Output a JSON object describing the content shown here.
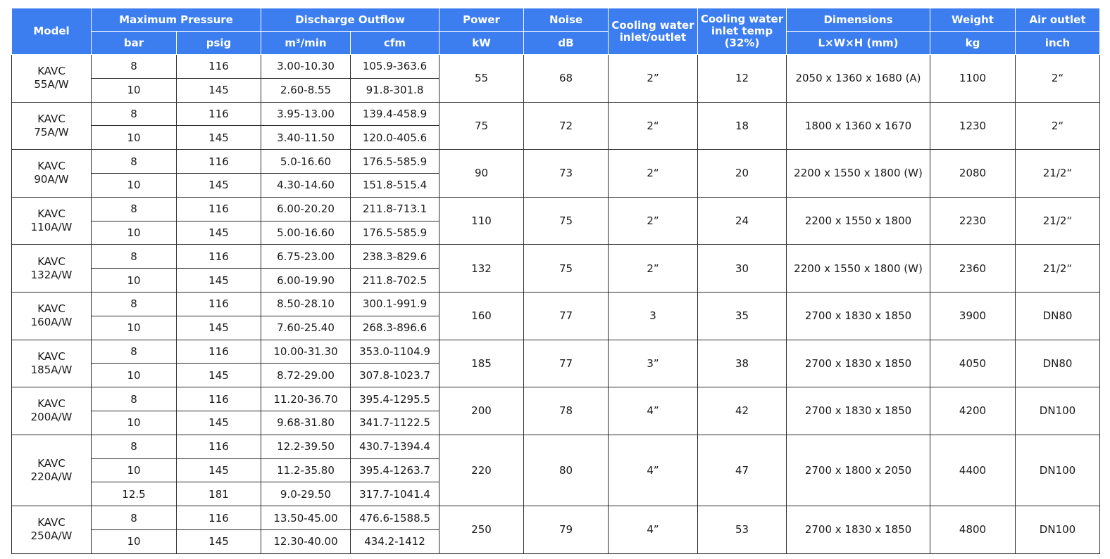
{
  "header": {
    "model": "Model",
    "max_pressure": "Maximum Pressure",
    "discharge": "Discharge Outflow",
    "power": "Power",
    "noise": "Noise",
    "cooling_io": "Cooling water inlet/outlet",
    "cooling_temp": "Cooling water inlet temp (32%)",
    "dimensions": "Dimensions",
    "weight": "Weight",
    "air_outlet": "Air outlet",
    "units": {
      "bar": "bar",
      "psig": "psig",
      "m3": "m³/min",
      "cfm": "cfm",
      "kw": "kW",
      "db": "dB",
      "lwh": "L×W×H (mm)",
      "kg": "kg",
      "inch": "inch"
    }
  },
  "models": [
    {
      "brand": "KAVC",
      "code": "55A/W",
      "power": "55",
      "noise": "68",
      "cooling_io": "2”",
      "cooling_temp": "12",
      "dimensions": "2050 x 1360 x 1680 (A)",
      "weight": "1100",
      "air_outlet": "2“",
      "rows": [
        {
          "bar": "8",
          "psig": "116",
          "m3": "3.00-10.30",
          "cfm": "105.9-363.6"
        },
        {
          "bar": "10",
          "psig": "145",
          "m3": "2.60-8.55",
          "cfm": "91.8-301.8"
        }
      ]
    },
    {
      "brand": "KAVC",
      "code": "75A/W",
      "power": "75",
      "noise": "72",
      "cooling_io": "2“",
      "cooling_temp": "18",
      "dimensions": "1800 x 1360 x 1670",
      "weight": "1230",
      "air_outlet": "2“",
      "rows": [
        {
          "bar": "8",
          "psig": "116",
          "m3": "3.95-13.00",
          "cfm": "139.4-458.9"
        },
        {
          "bar": "10",
          "psig": "145",
          "m3": "3.40-11.50",
          "cfm": "120.0-405.6"
        }
      ]
    },
    {
      "brand": "KAVC",
      "code": "90A/W",
      "power": "90",
      "noise": "73",
      "cooling_io": "2“",
      "cooling_temp": "20",
      "dimensions": "2200 x 1550 x 1800 (W)",
      "weight": "2080",
      "air_outlet": "21/2“",
      "rows": [
        {
          "bar": "8",
          "psig": "116",
          "m3": "5.0-16.60",
          "cfm": "176.5-585.9"
        },
        {
          "bar": "10",
          "psig": "145",
          "m3": "4.30-14.60",
          "cfm": "151.8-515.4"
        }
      ]
    },
    {
      "brand": "KAVC",
      "code": "110A/W",
      "power": "110",
      "noise": "75",
      "cooling_io": "2”",
      "cooling_temp": "24",
      "dimensions": "2200 x 1550 x 1800",
      "weight": "2230",
      "air_outlet": "21/2“",
      "rows": [
        {
          "bar": "8",
          "psig": "116",
          "m3": "6.00-20.20",
          "cfm": "211.8-713.1"
        },
        {
          "bar": "10",
          "psig": "145",
          "m3": "5.00-16.60",
          "cfm": "176.5-585.9"
        }
      ]
    },
    {
      "brand": "KAVC",
      "code": "132A/W",
      "power": "132",
      "noise": "75",
      "cooling_io": "2”",
      "cooling_temp": "30",
      "dimensions": "2200 x 1550 x 1800 (W)",
      "weight": "2360",
      "air_outlet": "21/2“",
      "rows": [
        {
          "bar": "8",
          "psig": "116",
          "m3": "6.75-23.00",
          "cfm": "238.3-829.6"
        },
        {
          "bar": "10",
          "psig": "145",
          "m3": "6.00-19.90",
          "cfm": "211.8-702.5"
        }
      ]
    },
    {
      "brand": "KAVC",
      "code": "160A/W",
      "power": "160",
      "noise": "77",
      "cooling_io": "3",
      "cooling_temp": "35",
      "dimensions": "2700 x 1830 x 1850",
      "weight": "3900",
      "air_outlet": "DN80",
      "rows": [
        {
          "bar": "8",
          "psig": "116",
          "m3": "8.50-28.10",
          "cfm": "300.1-991.9"
        },
        {
          "bar": "10",
          "psig": "145",
          "m3": "7.60-25.40",
          "cfm": "268.3-896.6"
        }
      ]
    },
    {
      "brand": "KAVC",
      "code": "185A/W",
      "power": "185",
      "noise": "77",
      "cooling_io": "3”",
      "cooling_temp": "38",
      "dimensions": "2700 x 1830 x 1850",
      "weight": "4050",
      "air_outlet": "DN80",
      "rows": [
        {
          "bar": "8",
          "psig": "116",
          "m3": "10.00-31.30",
          "cfm": "353.0-1104.9"
        },
        {
          "bar": "10",
          "psig": "145",
          "m3": "8.72-29.00",
          "cfm": "307.8-1023.7"
        }
      ]
    },
    {
      "brand": "KAVC",
      "code": "200A/W",
      "power": "200",
      "noise": "78",
      "cooling_io": "4”",
      "cooling_temp": "42",
      "dimensions": "2700 x 1830 x 1850",
      "weight": "4200",
      "air_outlet": "DN100",
      "rows": [
        {
          "bar": "8",
          "psig": "116",
          "m3": "11.20-36.70",
          "cfm": "395.4-1295.5"
        },
        {
          "bar": "10",
          "psig": "145",
          "m3": "9.68-31.80",
          "cfm": "341.7-1122.5"
        }
      ]
    },
    {
      "brand": "KAVC",
      "code": "220A/W",
      "power": "220",
      "noise": "80",
      "cooling_io": "4”",
      "cooling_temp": "47",
      "dimensions": "2700 x 1800 x 2050",
      "weight": "4400",
      "air_outlet": "DN100",
      "rows": [
        {
          "bar": "8",
          "psig": "116",
          "m3": "12.2-39.50",
          "cfm": "430.7-1394.4"
        },
        {
          "bar": "10",
          "psig": "145",
          "m3": "11.2-35.80",
          "cfm": "395.4-1263.7"
        },
        {
          "bar": "12.5",
          "psig": "181",
          "m3": "9.0-29.50",
          "cfm": "317.7-1041.4"
        }
      ]
    },
    {
      "brand": "KAVC",
      "code": "250A/W",
      "power": "250",
      "noise": "79",
      "cooling_io": "4”",
      "cooling_temp": "53",
      "dimensions": "2700 x 1830 x 1850",
      "weight": "4800",
      "air_outlet": "DN100",
      "rows": [
        {
          "bar": "8",
          "psig": "116",
          "m3": "13.50-45.00",
          "cfm": "476.6-1588.5"
        },
        {
          "bar": "10",
          "psig": "145",
          "m3": "12.30-40.00",
          "cfm": "434.2-1412"
        }
      ]
    }
  ]
}
